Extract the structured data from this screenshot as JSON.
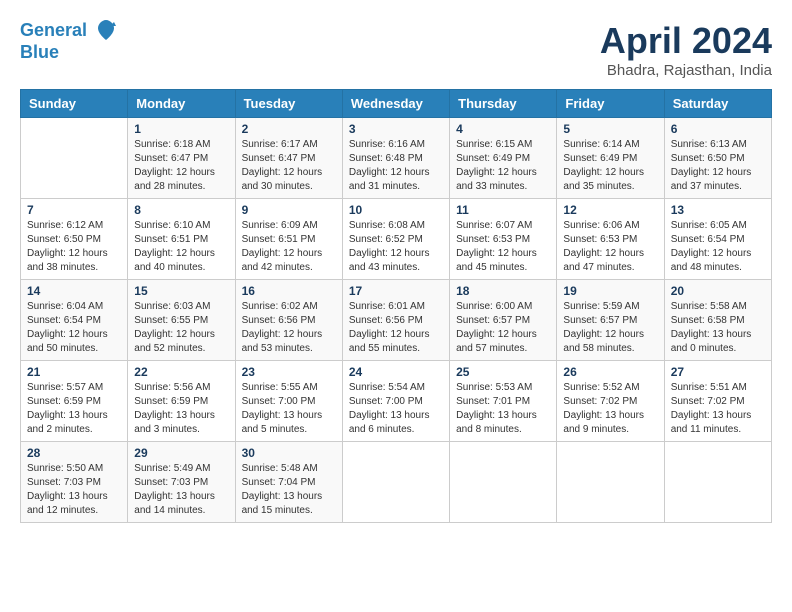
{
  "header": {
    "logo_line1": "General",
    "logo_line2": "Blue",
    "title": "April 2024",
    "location": "Bhadra, Rajasthan, India"
  },
  "weekdays": [
    "Sunday",
    "Monday",
    "Tuesday",
    "Wednesday",
    "Thursday",
    "Friday",
    "Saturday"
  ],
  "weeks": [
    [
      {
        "day": "",
        "info": ""
      },
      {
        "day": "1",
        "info": "Sunrise: 6:18 AM\nSunset: 6:47 PM\nDaylight: 12 hours\nand 28 minutes."
      },
      {
        "day": "2",
        "info": "Sunrise: 6:17 AM\nSunset: 6:47 PM\nDaylight: 12 hours\nand 30 minutes."
      },
      {
        "day": "3",
        "info": "Sunrise: 6:16 AM\nSunset: 6:48 PM\nDaylight: 12 hours\nand 31 minutes."
      },
      {
        "day": "4",
        "info": "Sunrise: 6:15 AM\nSunset: 6:49 PM\nDaylight: 12 hours\nand 33 minutes."
      },
      {
        "day": "5",
        "info": "Sunrise: 6:14 AM\nSunset: 6:49 PM\nDaylight: 12 hours\nand 35 minutes."
      },
      {
        "day": "6",
        "info": "Sunrise: 6:13 AM\nSunset: 6:50 PM\nDaylight: 12 hours\nand 37 minutes."
      }
    ],
    [
      {
        "day": "7",
        "info": "Sunrise: 6:12 AM\nSunset: 6:50 PM\nDaylight: 12 hours\nand 38 minutes."
      },
      {
        "day": "8",
        "info": "Sunrise: 6:10 AM\nSunset: 6:51 PM\nDaylight: 12 hours\nand 40 minutes."
      },
      {
        "day": "9",
        "info": "Sunrise: 6:09 AM\nSunset: 6:51 PM\nDaylight: 12 hours\nand 42 minutes."
      },
      {
        "day": "10",
        "info": "Sunrise: 6:08 AM\nSunset: 6:52 PM\nDaylight: 12 hours\nand 43 minutes."
      },
      {
        "day": "11",
        "info": "Sunrise: 6:07 AM\nSunset: 6:53 PM\nDaylight: 12 hours\nand 45 minutes."
      },
      {
        "day": "12",
        "info": "Sunrise: 6:06 AM\nSunset: 6:53 PM\nDaylight: 12 hours\nand 47 minutes."
      },
      {
        "day": "13",
        "info": "Sunrise: 6:05 AM\nSunset: 6:54 PM\nDaylight: 12 hours\nand 48 minutes."
      }
    ],
    [
      {
        "day": "14",
        "info": "Sunrise: 6:04 AM\nSunset: 6:54 PM\nDaylight: 12 hours\nand 50 minutes."
      },
      {
        "day": "15",
        "info": "Sunrise: 6:03 AM\nSunset: 6:55 PM\nDaylight: 12 hours\nand 52 minutes."
      },
      {
        "day": "16",
        "info": "Sunrise: 6:02 AM\nSunset: 6:56 PM\nDaylight: 12 hours\nand 53 minutes."
      },
      {
        "day": "17",
        "info": "Sunrise: 6:01 AM\nSunset: 6:56 PM\nDaylight: 12 hours\nand 55 minutes."
      },
      {
        "day": "18",
        "info": "Sunrise: 6:00 AM\nSunset: 6:57 PM\nDaylight: 12 hours\nand 57 minutes."
      },
      {
        "day": "19",
        "info": "Sunrise: 5:59 AM\nSunset: 6:57 PM\nDaylight: 12 hours\nand 58 minutes."
      },
      {
        "day": "20",
        "info": "Sunrise: 5:58 AM\nSunset: 6:58 PM\nDaylight: 13 hours\nand 0 minutes."
      }
    ],
    [
      {
        "day": "21",
        "info": "Sunrise: 5:57 AM\nSunset: 6:59 PM\nDaylight: 13 hours\nand 2 minutes."
      },
      {
        "day": "22",
        "info": "Sunrise: 5:56 AM\nSunset: 6:59 PM\nDaylight: 13 hours\nand 3 minutes."
      },
      {
        "day": "23",
        "info": "Sunrise: 5:55 AM\nSunset: 7:00 PM\nDaylight: 13 hours\nand 5 minutes."
      },
      {
        "day": "24",
        "info": "Sunrise: 5:54 AM\nSunset: 7:00 PM\nDaylight: 13 hours\nand 6 minutes."
      },
      {
        "day": "25",
        "info": "Sunrise: 5:53 AM\nSunset: 7:01 PM\nDaylight: 13 hours\nand 8 minutes."
      },
      {
        "day": "26",
        "info": "Sunrise: 5:52 AM\nSunset: 7:02 PM\nDaylight: 13 hours\nand 9 minutes."
      },
      {
        "day": "27",
        "info": "Sunrise: 5:51 AM\nSunset: 7:02 PM\nDaylight: 13 hours\nand 11 minutes."
      }
    ],
    [
      {
        "day": "28",
        "info": "Sunrise: 5:50 AM\nSunset: 7:03 PM\nDaylight: 13 hours\nand 12 minutes."
      },
      {
        "day": "29",
        "info": "Sunrise: 5:49 AM\nSunset: 7:03 PM\nDaylight: 13 hours\nand 14 minutes."
      },
      {
        "day": "30",
        "info": "Sunrise: 5:48 AM\nSunset: 7:04 PM\nDaylight: 13 hours\nand 15 minutes."
      },
      {
        "day": "",
        "info": ""
      },
      {
        "day": "",
        "info": ""
      },
      {
        "day": "",
        "info": ""
      },
      {
        "day": "",
        "info": ""
      }
    ]
  ]
}
